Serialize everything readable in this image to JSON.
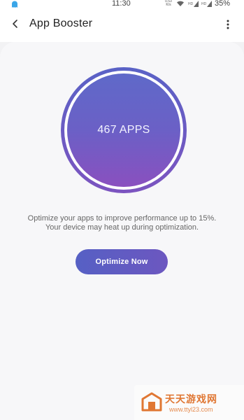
{
  "status_bar": {
    "time": "11:30",
    "net_speed_value": "0.53",
    "net_speed_unit": "K/s",
    "battery": "35%"
  },
  "header": {
    "title": "App Booster",
    "back_icon": "back-arrow-icon",
    "more_icon": "more-vertical-icon"
  },
  "booster": {
    "app_count": "467 APPS"
  },
  "description": {
    "line1": "Optimize your apps to improve performance up to 15%.",
    "line2": "Your device may heat up during optimization."
  },
  "optimize_button": {
    "label": "Optimize Now"
  },
  "watermark": {
    "text": "天天游戏网",
    "url": "www.ttyl23.com"
  },
  "colors": {
    "accent": "#5f69c9",
    "accent_bottom": "#8a50bf",
    "background": "#f2f2f4",
    "watermark": "#e07733"
  }
}
